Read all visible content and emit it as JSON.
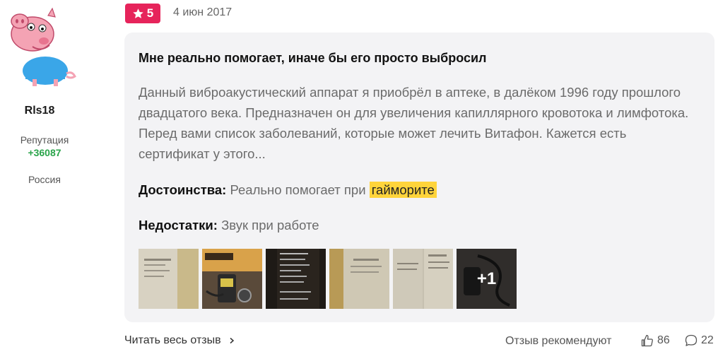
{
  "author": {
    "username": "Rls18",
    "reputation_label": "Репутация",
    "reputation_value": "+36087",
    "country": "Россия",
    "avatar_icon": "peppa-pig-avatar"
  },
  "review": {
    "rating": "5",
    "rating_color": "#e6245b",
    "date": "4 июн 2017",
    "title": "Мне реально помогает, иначе бы его просто выбросил",
    "text": "Данный виброакустический аппарат я приобрёл в аптеке, в далёком 1996 году прошлого двадцатого века. Предназначен он для увеличения капиллярного кровотока и лимфотока. Перед вами список заболеваний, которые может лечить Витафон. Кажется есть сертификат у этого...",
    "pros_label": "Достоинства:",
    "pros_text": "Реально помогает при",
    "pros_highlight": "гайморите",
    "highlight_color": "#ffd43b",
    "cons_label": "Недостатки:",
    "cons_text": "Звук при работе",
    "photos_more": "+1"
  },
  "footer": {
    "read_more": "Читать весь отзыв",
    "recommend_label": "Отзыв рекомендуют",
    "likes": "86",
    "comments": "22"
  }
}
